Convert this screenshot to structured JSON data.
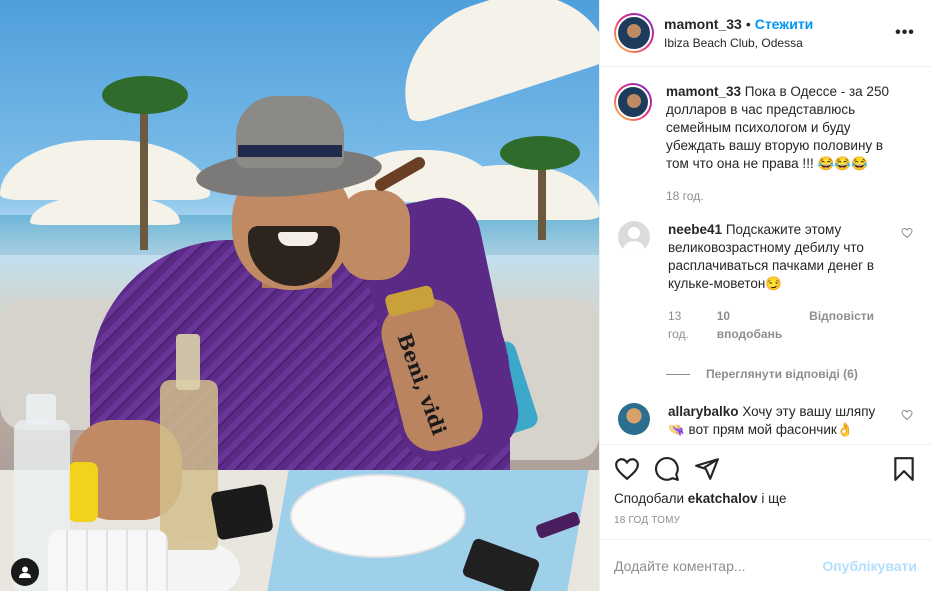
{
  "post": {
    "username": "mamont_33",
    "separator": "•",
    "follow_label": "Стежити",
    "location": "Ibiza Beach Club, Odessa",
    "more_label": "•••",
    "tattoo_text": "Beni, vidi"
  },
  "caption": {
    "username": "mamont_33",
    "text": "Пока в Одессе - за 250 долларов в час представлюсь семейным психологом и буду убеждать вашу вторую половину в том что она не права !!! 😂😂😂",
    "time": "18 год."
  },
  "comments": [
    {
      "username": "neebe41",
      "text": "Подскажите этому великовозрастному дебилу что расплачиваться пачками денег в кульке-моветон😏",
      "time": "13 год.",
      "likes": "10 вподобань",
      "reply_label": "Відповісти",
      "view_replies": "Переглянути відповіді (6)"
    },
    {
      "username": "allarybalko",
      "text": "Хочу эту вашу шляпу 👒 вот прям мой фасончик👌"
    }
  ],
  "actions": {
    "likes_prefix": "Сподобали",
    "likes_user": "ekatchalov",
    "likes_suffix": "і ще",
    "posted_time": "18 ГОД ТОМУ"
  },
  "add_comment": {
    "placeholder": "Додайте коментар...",
    "publish_label": "Опублікувати"
  },
  "icons": [
    "user-tag-icon",
    "more-icon",
    "heart-icon",
    "comment-icon",
    "share-icon",
    "save-icon"
  ]
}
